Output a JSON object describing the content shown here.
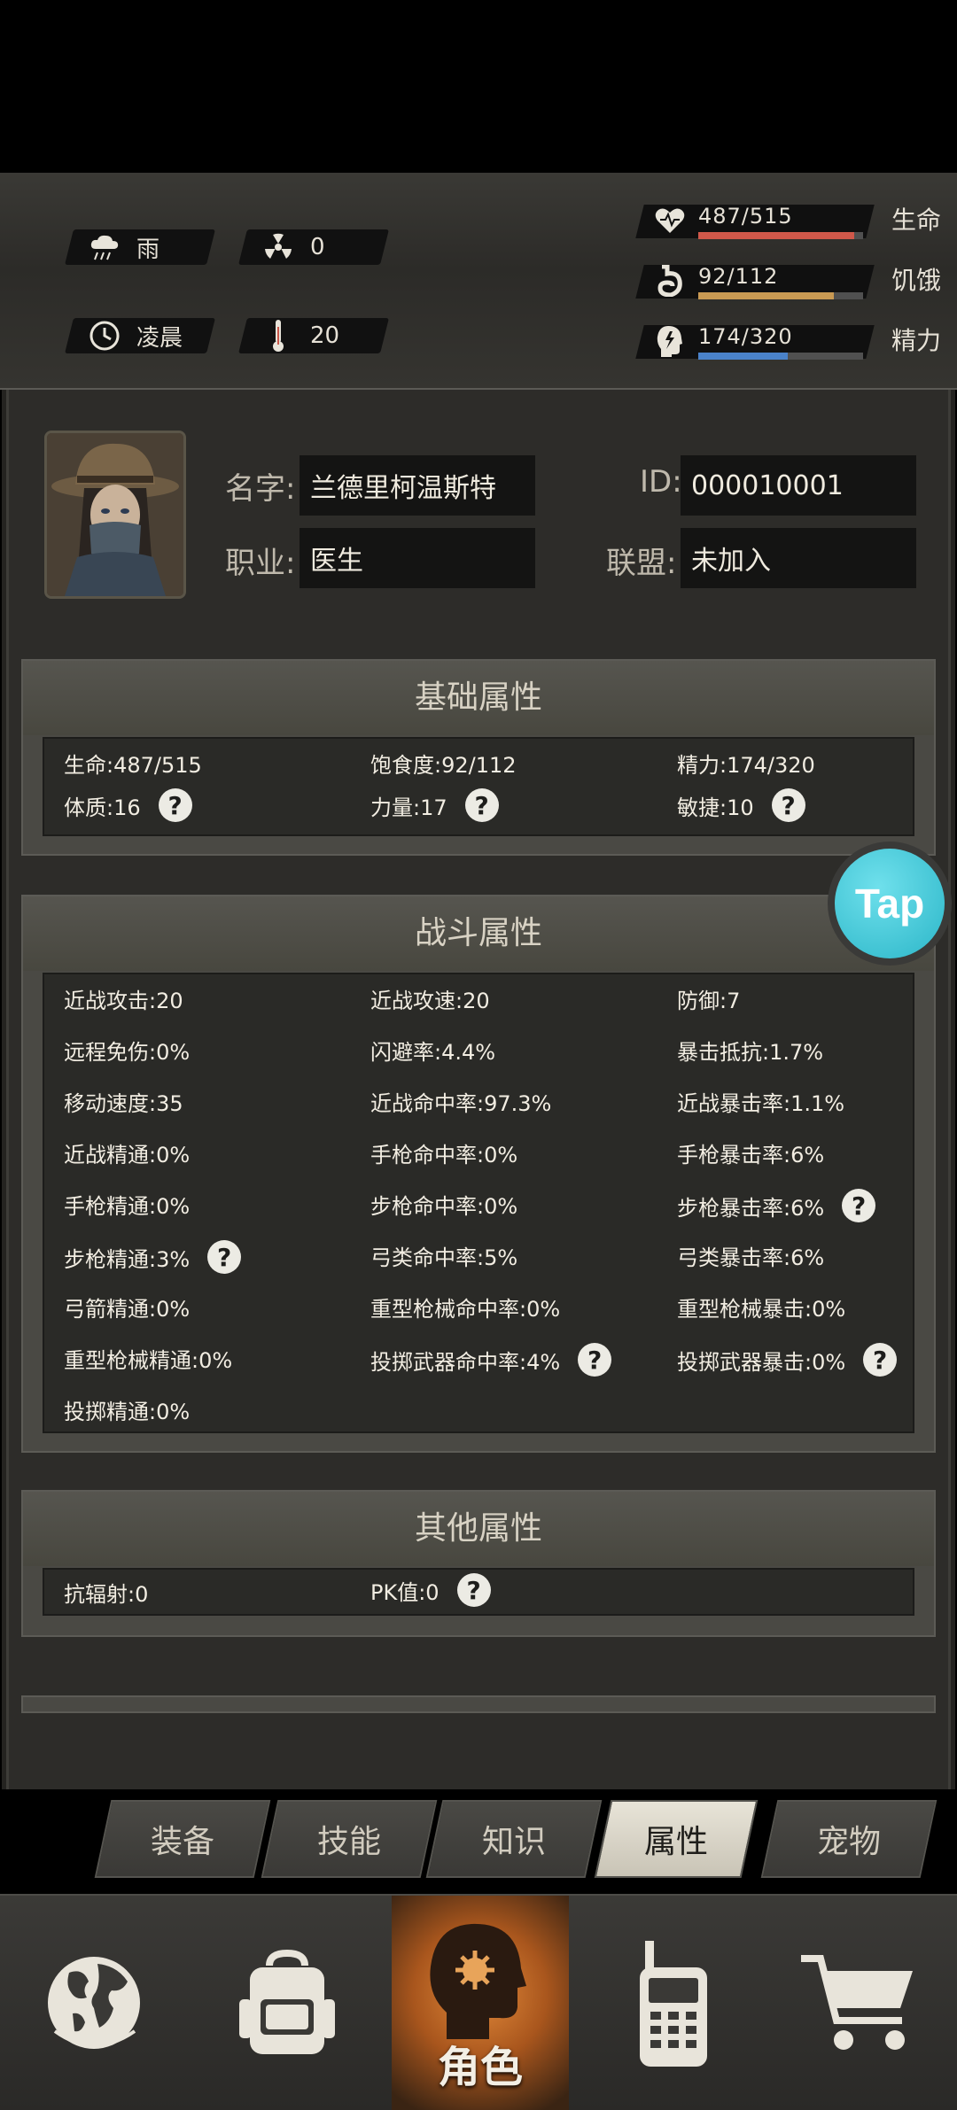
{
  "weather": {
    "condition": "雨",
    "radiation": "0",
    "time_of_day": "凌晨",
    "temperature": "20"
  },
  "vitals": [
    {
      "value": "487/515",
      "label": "生命",
      "fraction": 0.946,
      "color": "#d0584a",
      "icon": "heart-icon"
    },
    {
      "value": "92/112",
      "label": "饥饿",
      "fraction": 0.821,
      "color": "#c99a53",
      "icon": "stomach-icon"
    },
    {
      "value": "174/320",
      "label": "精力",
      "fraction": 0.544,
      "color": "#4a82c9",
      "icon": "brain-icon"
    }
  ],
  "profile": {
    "name_label": "名字:",
    "name": "兰德里柯温斯特",
    "id_label": "ID:",
    "id": "000010001",
    "job_label": "职业:",
    "job": "医生",
    "alliance_label": "联盟:",
    "alliance": "未加入"
  },
  "basic": {
    "title": "基础属性",
    "rows": [
      [
        "生命:487/515",
        "饱食度:92/112",
        "精力:174/320"
      ],
      [
        "体质:16",
        "力量:17",
        "敏捷:10"
      ]
    ]
  },
  "combat": {
    "title": "战斗属性",
    "rows": [
      [
        "近战攻击:20",
        "近战攻速:20",
        "防御:7"
      ],
      [
        "远程免伤:0%",
        "闪避率:4.4%",
        "暴击抵抗:1.7%"
      ],
      [
        "移动速度:35",
        "近战命中率:97.3%",
        "近战暴击率:1.1%"
      ],
      [
        "近战精通:0%",
        "手枪命中率:0%",
        "手枪暴击率:6%"
      ],
      [
        "手枪精通:0%",
        "步枪命中率:0%",
        "步枪暴击率:6%"
      ],
      [
        "步枪精通:3%",
        "弓类命中率:5%",
        "弓类暴击率:6%"
      ],
      [
        "弓箭精通:0%",
        "重型枪械命中率:0%",
        "重型枪械暴击:0%"
      ],
      [
        "重型枪械精通:0%",
        "投掷武器命中率:4%",
        "投掷武器暴击:0%"
      ],
      [
        "投掷精通:0%",
        "",
        ""
      ]
    ]
  },
  "other": {
    "title": "其他属性",
    "rows": [
      [
        "抗辐射:0",
        "PK值:0"
      ]
    ]
  },
  "help_mark": "?",
  "tap_label": "Tap",
  "tabs": [
    "装备",
    "技能",
    "知识",
    "属性",
    "宠物"
  ],
  "active_tab": 3,
  "nav": {
    "active_label": "角色",
    "items": [
      "globe-icon",
      "backpack-icon",
      "character-icon",
      "walkie-talkie-icon",
      "shopping-cart-icon"
    ]
  }
}
